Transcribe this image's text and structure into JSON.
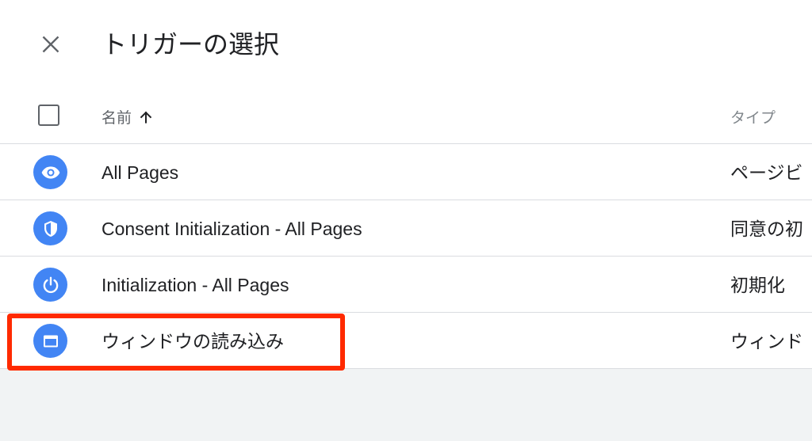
{
  "header": {
    "title": "トリガーの選択",
    "close_icon": "close-icon"
  },
  "columns": {
    "name": "名前",
    "type": "タイプ",
    "sort_icon": "arrow-up-icon"
  },
  "triggers": [
    {
      "name": "All Pages",
      "type": "ページビ",
      "icon": "eye-icon"
    },
    {
      "name": "Consent Initialization - All Pages",
      "type": "同意の初",
      "icon": "shield-icon"
    },
    {
      "name": "Initialization - All Pages",
      "type": "初期化",
      "icon": "power-icon"
    },
    {
      "name": "ウィンドウの読み込み",
      "type": "ウィンド",
      "icon": "window-icon"
    }
  ],
  "colors": {
    "accent": "#4285f4",
    "highlight": "#ff2a00",
    "divider": "#dadce0",
    "footer_bg": "#f1f3f4"
  }
}
